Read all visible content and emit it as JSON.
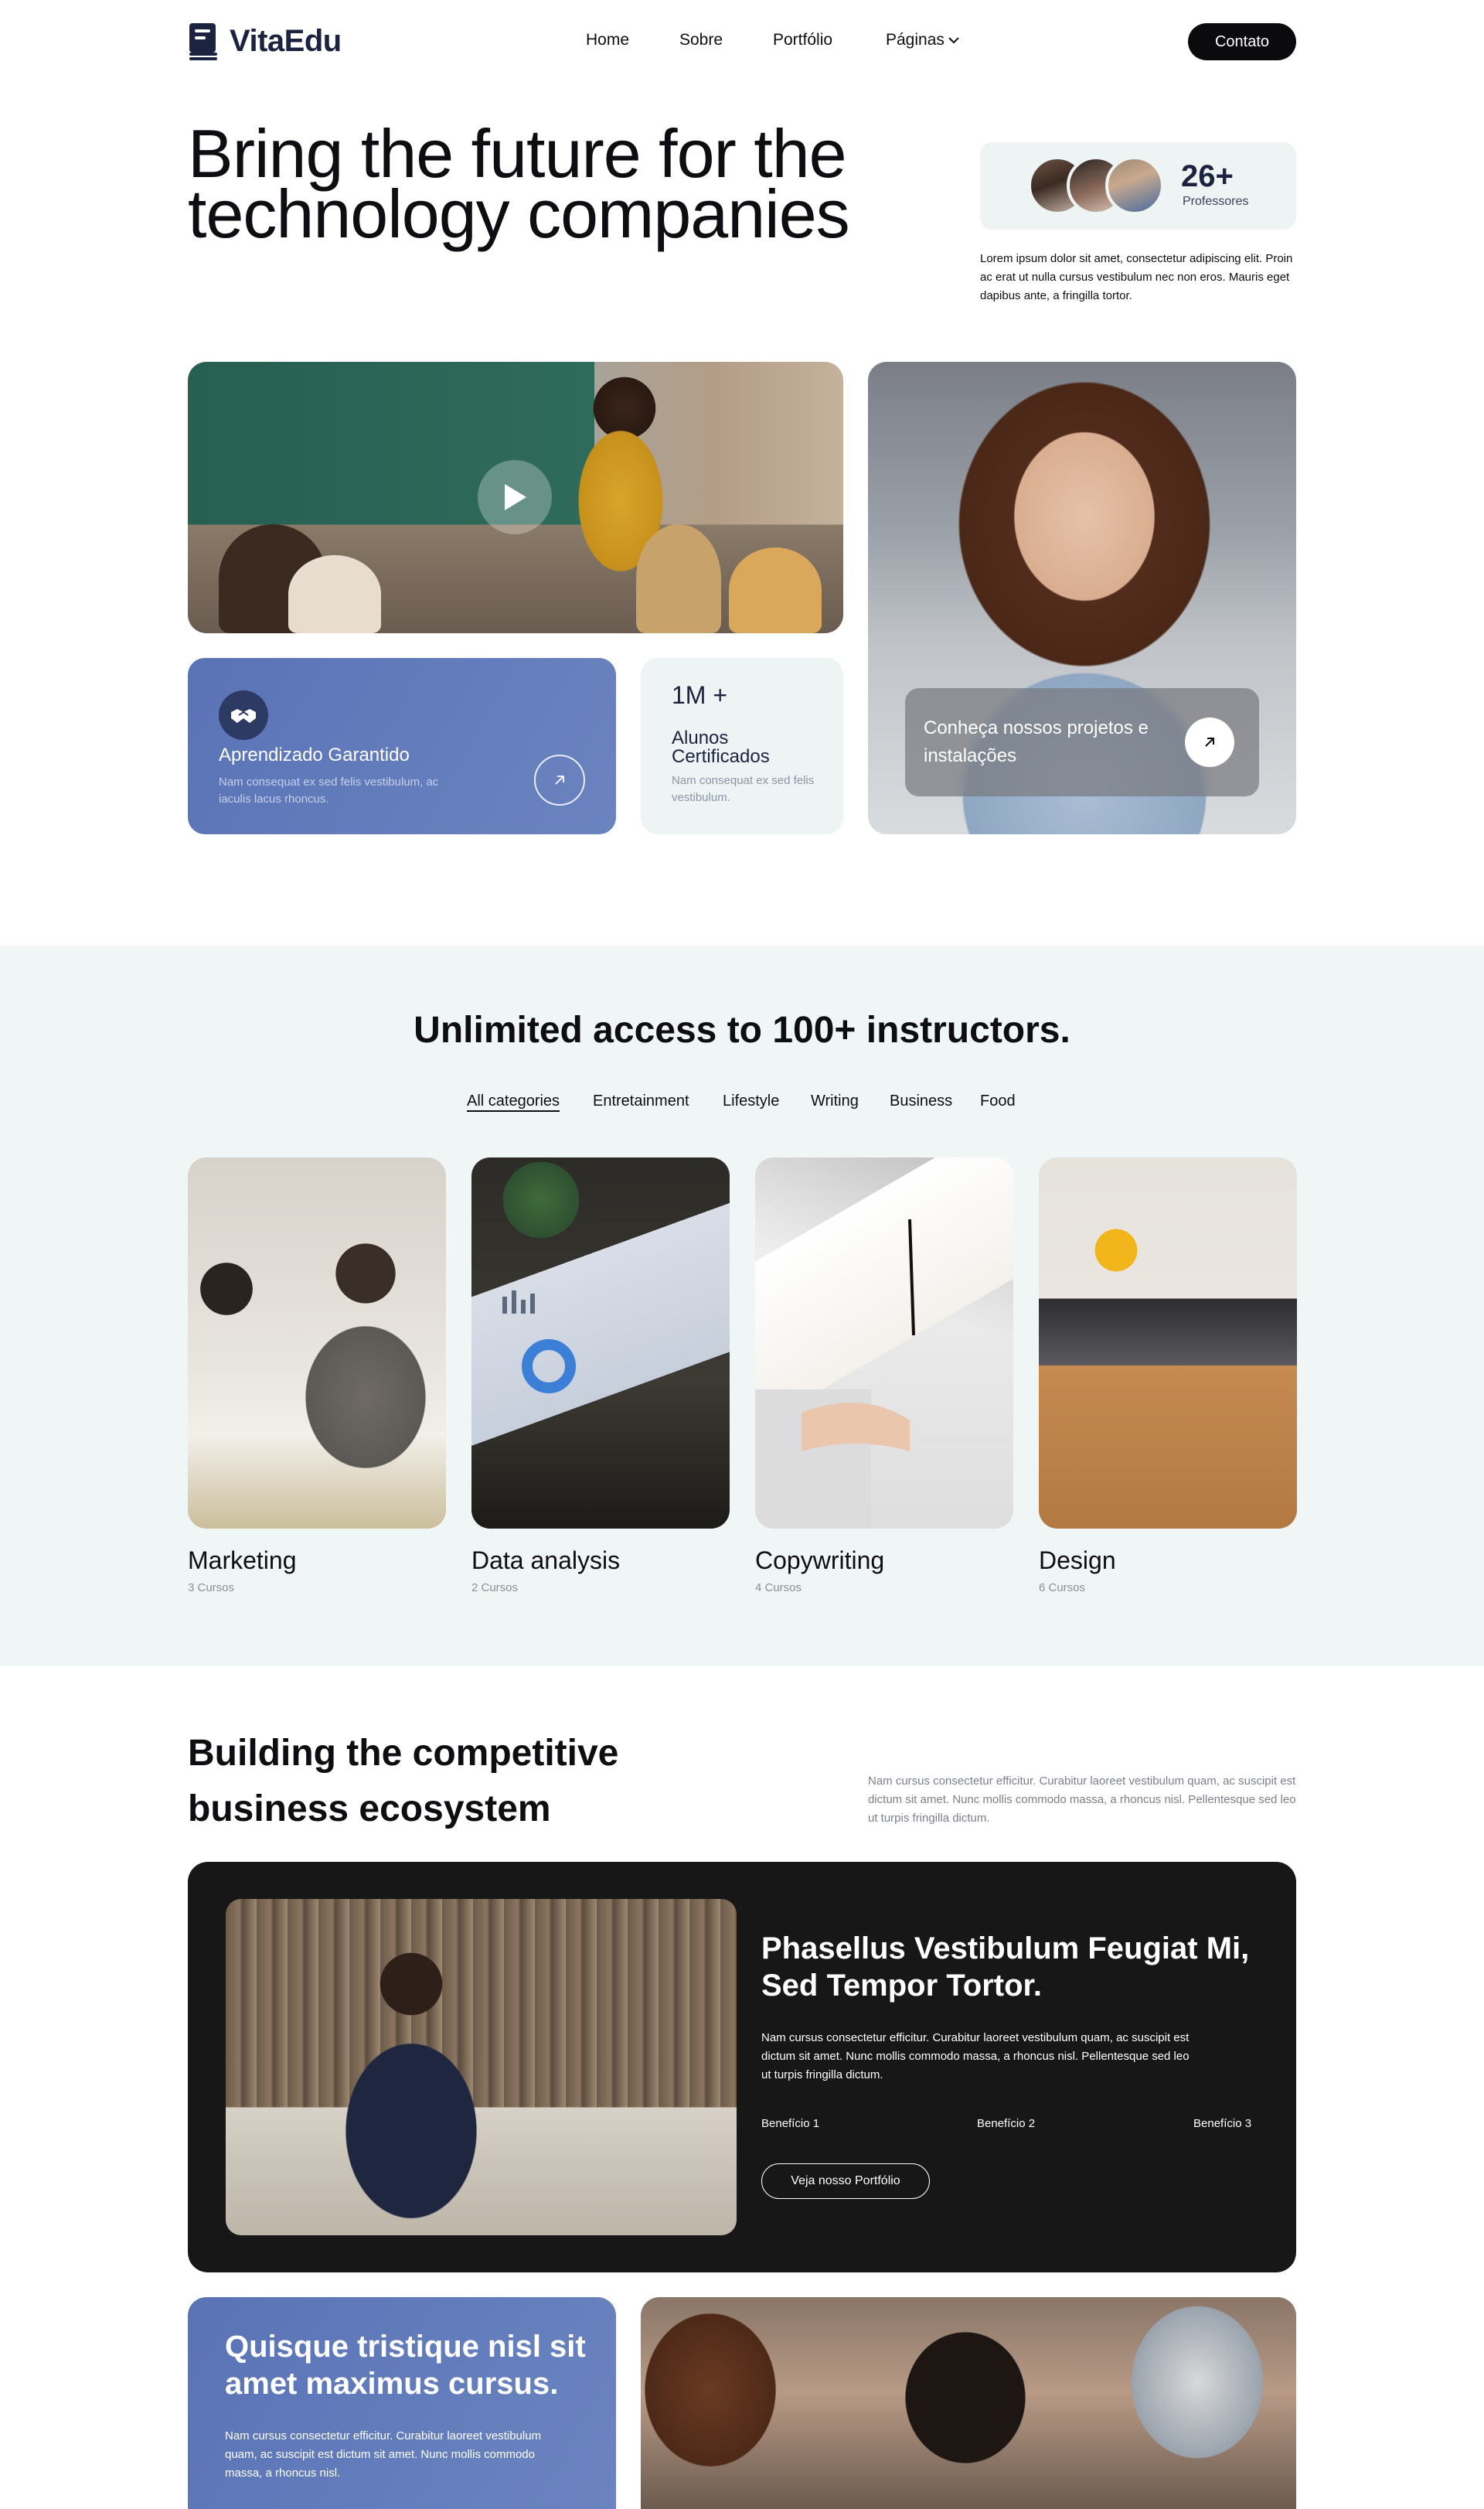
{
  "brand": {
    "name": "VitaEdu",
    "color": "#1c2340"
  },
  "nav": {
    "links": [
      "Home",
      "Sobre",
      "Portfólio",
      "Páginas"
    ],
    "contact_label": "Contato"
  },
  "hero": {
    "title": "Bring the future for the technology companies",
    "professors": {
      "count": "26+",
      "label": "Professores"
    },
    "description": "Lorem ipsum dolor sit amet, consectetur adipiscing elit. Proin ac erat ut nulla cursus vestibulum nec non eros. Mauris eget dapibus ante, a fringilla tortor.",
    "guarantee_card": {
      "title": "Aprendizado Garantido",
      "text": "Nam consequat ex sed felis vestibulum, ac iaculis lacus rhoncus."
    },
    "stat_card": {
      "number": "1M +",
      "title": "Alunos Certificados",
      "text": "Nam consequat ex sed felis vestibulum."
    },
    "projects_card": {
      "text": "Conheça nossos projetos e instalações"
    }
  },
  "instructors": {
    "title": "Unlimited access to 100+ instructors.",
    "categories": [
      "All categories",
      "Entretainment",
      "Lifestyle",
      "Writing",
      "Business",
      "Food"
    ],
    "active_category": "All categories",
    "courses": [
      {
        "name": "Marketing",
        "count": "3 Cursos"
      },
      {
        "name": "Data analysis",
        "count": "2 Cursos"
      },
      {
        "name": "Copywriting",
        "count": "4 Cursos"
      },
      {
        "name": "Design",
        "count": "6 Cursos"
      }
    ]
  },
  "ecosystem": {
    "title": "Building the competitive business ecosystem",
    "description": "Nam cursus consectetur efficitur. Curabitur laoreet vestibulum quam, ac suscipit est dictum sit amet. Nunc mollis commodo massa, a rhoncus nisl. Pellentesque sed leo ut turpis fringilla dictum.",
    "feature": {
      "title": "Phasellus Vestibulum Feugiat Mi, Sed Tempor Tortor.",
      "text": "Nam cursus consectetur efficitur. Curabitur laoreet vestibulum quam, ac suscipit est dictum sit amet. Nunc mollis commodo massa, a rhoncus nisl. Pellentesque sed leo ut turpis fringilla dictum.",
      "benefits": [
        "Benefício 1",
        "Benefício 2",
        "Benefício 3"
      ],
      "button_label": "Veja nosso Portfólio"
    },
    "bottom_card": {
      "title": "Quisque tristique nisl sit amet maximus cursus.",
      "text": "Nam cursus consectetur efficitur. Curabitur laoreet vestibulum quam, ac suscipit est dictum sit amet. Nunc mollis commodo massa, a rhoncus nisl."
    }
  },
  "colors": {
    "accent_blue": "#5a73b6",
    "dark_card": "#171717",
    "light_panel": "#eef3f3"
  },
  "icons": [
    "book-logo-icon",
    "chevron-down-icon",
    "play-icon",
    "handshake-icon",
    "arrow-up-right-icon"
  ]
}
